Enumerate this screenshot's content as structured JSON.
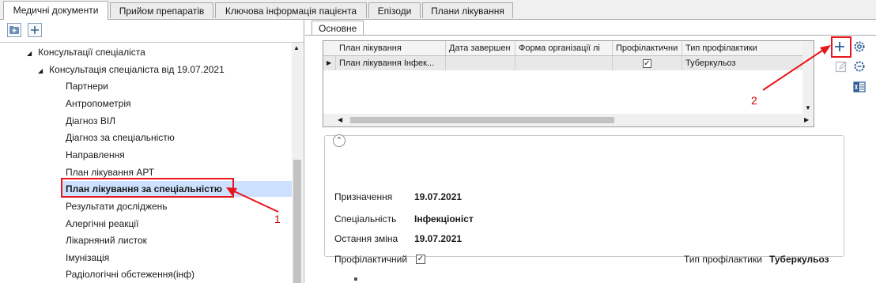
{
  "top_tabs": [
    "Медичні документи",
    "Прийом препаратів",
    "Ключова інформація пацієнта",
    "Епізоди",
    "Плани лікування"
  ],
  "tree": {
    "items": [
      {
        "label": "Консультації спеціаліста",
        "level": 0,
        "expanded": true
      },
      {
        "label": "Консультація спеціаліста від 19.07.2021",
        "level": 1,
        "expanded": true
      },
      {
        "label": "Партнери",
        "level": 2
      },
      {
        "label": "Антропометрія",
        "level": 2
      },
      {
        "label": "Діагноз ВІЛ",
        "level": 2
      },
      {
        "label": "Діагноз за спеціальністю",
        "level": 2
      },
      {
        "label": "Направлення",
        "level": 2
      },
      {
        "label": "План лікування АРТ",
        "level": 2
      },
      {
        "label": "План лікування за спеціальністю",
        "level": 2,
        "selected": true
      },
      {
        "label": "Результати досліджень",
        "level": 2
      },
      {
        "label": "Алергічні реакції",
        "level": 2
      },
      {
        "label": "Лікарняний листок",
        "level": 2
      },
      {
        "label": "Імунізація",
        "level": 2
      },
      {
        "label": "Радіологічні обстеження(інф)",
        "level": 2
      }
    ]
  },
  "subtab": "Основне",
  "grid": {
    "columns": [
      "План лікування",
      "Дата завершен",
      "Форма організації лі",
      "Профілактични",
      "Тип профілактики"
    ],
    "rows": [
      {
        "plan": "План лікування Інфек...",
        "end_date": "",
        "form": "",
        "preventive": true,
        "type": "Туберкульоз"
      }
    ]
  },
  "details": {
    "assigned_label": "Призначення",
    "assigned_value": "19.07.2021",
    "specialty_label": "Спеціальність",
    "specialty_value": "Інфекціоніст",
    "last_change_label": "Остання зміна",
    "last_change_value": "19.07.2021",
    "preventive_label": "Профілактичний",
    "preventive_checked": true,
    "prevention_type_label": "Тип профілактики",
    "prevention_type_value": "Туберкульоз"
  },
  "annotations": {
    "label1": "1",
    "label2": "2"
  },
  "colors": {
    "highlight": "#e8161b",
    "selection": "#cce0ff"
  }
}
